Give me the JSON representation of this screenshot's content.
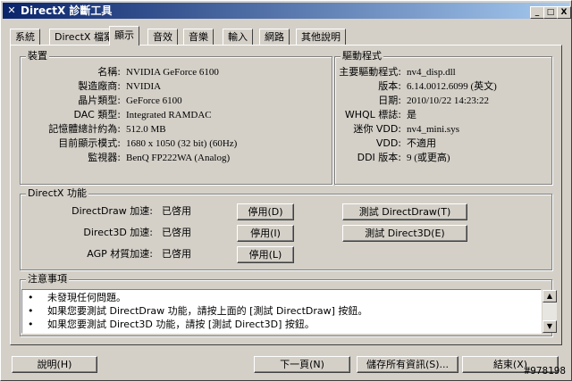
{
  "window": {
    "title": "DirectX 診斷工具",
    "controls": [
      "_",
      "□",
      "X"
    ]
  },
  "tabs": [
    {
      "label": "系統"
    },
    {
      "label": "DirectX 檔案"
    },
    {
      "label": "顯示"
    },
    {
      "label": "音效"
    },
    {
      "label": "音樂"
    },
    {
      "label": "輸入"
    },
    {
      "label": "網路"
    },
    {
      "label": "其他說明"
    }
  ],
  "device": {
    "title": "裝置",
    "rows": [
      {
        "label": "名稱:",
        "value": "NVIDIA GeForce 6100"
      },
      {
        "label": "製造廠商:",
        "value": "NVIDIA"
      },
      {
        "label": "晶片類型:",
        "value": "GeForce 6100"
      },
      {
        "label": "DAC 類型:",
        "value": "Integrated RAMDAC"
      },
      {
        "label": "記憶體總計約為:",
        "value": "512.0 MB"
      },
      {
        "label": "目前顯示模式:",
        "value": "1680 x 1050 (32 bit) (60Hz)"
      },
      {
        "label": "監視器:",
        "value": "BenQ FP222WA (Analog)"
      }
    ]
  },
  "driver": {
    "title": "驅動程式",
    "rows": [
      {
        "label": "主要驅動程式:",
        "value": "nv4_disp.dll"
      },
      {
        "label": "版本:",
        "value": "6.14.0012.6099 (英文)"
      },
      {
        "label": "日期:",
        "value": "2010/10/22 14:23:22"
      },
      {
        "label": "WHQL 標誌:",
        "value": "是"
      },
      {
        "label": "迷你 VDD:",
        "value": "nv4_mini.sys"
      },
      {
        "label": "VDD:",
        "value": "不適用"
      },
      {
        "label": "DDI 版本:",
        "value": "9 (或更高)"
      }
    ]
  },
  "directx": {
    "title": "DirectX 功能",
    "rows": [
      {
        "label": "DirectDraw 加速:",
        "status": "已啓用",
        "button": "停用(D)",
        "test": "測試 DirectDraw(T)"
      },
      {
        "label": "Direct3D 加速:",
        "status": "已啓用",
        "button": "停用(I)",
        "test": "測試 Direct3D(E)"
      },
      {
        "label": "AGP 材質加速:",
        "status": "已啓用",
        "button": "停用(L)",
        "test": ""
      }
    ]
  },
  "notes": {
    "title": "注意事項",
    "items": [
      "未發現任何問題。",
      "如果您要測試 DirectDraw 功能，請按上面的 [測試 DirectDraw] 按鈕。",
      "如果您要測試 Direct3D 功能，請按 [測試 Direct3D] 按鈕。"
    ]
  },
  "footer": {
    "help": "說明(H)",
    "next": "下一頁(N)",
    "save": "儲存所有資訊(S)...",
    "exit": "結束(X)"
  },
  "watermark": "#978198"
}
